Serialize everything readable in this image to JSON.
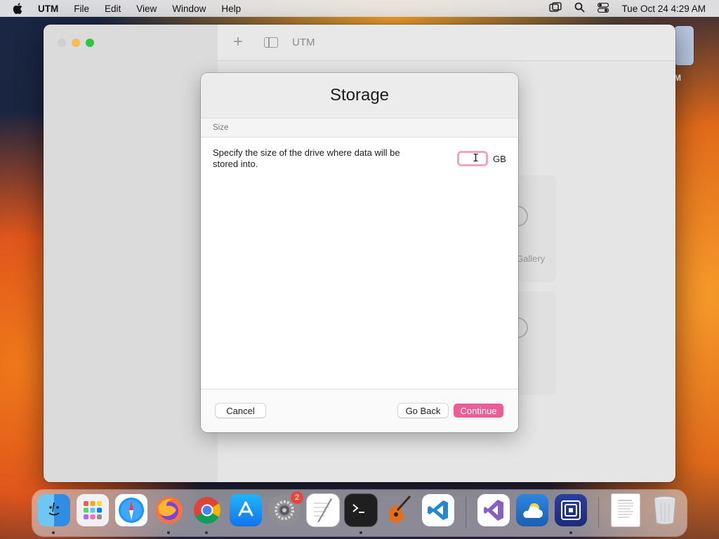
{
  "menubar": {
    "app_name": "UTM",
    "items": [
      "File",
      "Edit",
      "View",
      "Window",
      "Help"
    ],
    "clock": "Tue Oct 24  4:29 AM"
  },
  "window": {
    "title": "UTM",
    "background_gallery_label": "Gallery",
    "background_partial_label": "t"
  },
  "desktop": {
    "partial_icon_label": "M"
  },
  "sheet": {
    "title": "Storage",
    "section": "Size",
    "description": "Specify the size of the drive where data will be stored into.",
    "size_value": "",
    "unit": "GB",
    "buttons": {
      "cancel": "Cancel",
      "go_back": "Go Back",
      "continue": "Continue"
    },
    "accent_color": "#ea5d95"
  },
  "dock": {
    "apps": [
      {
        "name": "Finder",
        "icon": "finder-icon",
        "running": true
      },
      {
        "name": "Launchpad",
        "icon": "launchpad-icon",
        "running": false
      },
      {
        "name": "Safari",
        "icon": "safari-icon",
        "running": false
      },
      {
        "name": "Firefox",
        "icon": "firefox-icon",
        "running": true
      },
      {
        "name": "Chrome",
        "icon": "chrome-icon",
        "running": true
      },
      {
        "name": "App Store",
        "icon": "app-store-icon",
        "running": false
      },
      {
        "name": "System Settings",
        "icon": "system-settings-icon",
        "running": false,
        "badge": "2"
      },
      {
        "name": "TextEdit",
        "icon": "textedit-icon",
        "running": false
      },
      {
        "name": "Terminal",
        "icon": "terminal-icon",
        "running": true
      },
      {
        "name": "GarageBand",
        "icon": "garageband-icon",
        "running": false
      },
      {
        "name": "Visual Studio Code",
        "icon": "vscode-icon",
        "running": false
      },
      {
        "name": "Visual Studio",
        "icon": "visual-studio-icon",
        "running": false
      },
      {
        "name": "Weather",
        "icon": "weather-icon",
        "running": false
      },
      {
        "name": "UTM",
        "icon": "utm-icon",
        "running": true
      },
      {
        "name": "Document",
        "icon": "document-icon",
        "running": false
      },
      {
        "name": "Trash",
        "icon": "trash-icon",
        "running": false
      }
    ]
  }
}
